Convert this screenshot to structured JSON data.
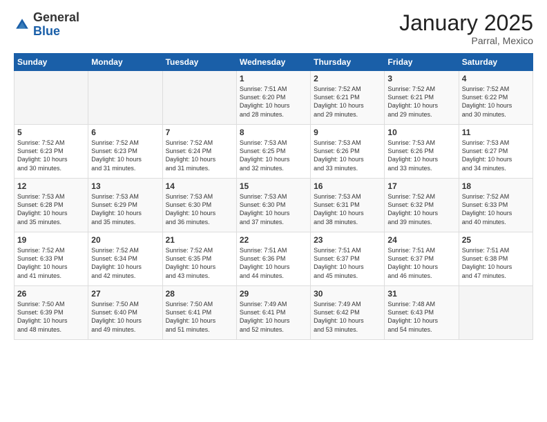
{
  "logo": {
    "general": "General",
    "blue": "Blue"
  },
  "header": {
    "title": "January 2025",
    "subtitle": "Parral, Mexico"
  },
  "days_of_week": [
    "Sunday",
    "Monday",
    "Tuesday",
    "Wednesday",
    "Thursday",
    "Friday",
    "Saturday"
  ],
  "weeks": [
    [
      {
        "day": "",
        "info": ""
      },
      {
        "day": "",
        "info": ""
      },
      {
        "day": "",
        "info": ""
      },
      {
        "day": "1",
        "info": "Sunrise: 7:51 AM\nSunset: 6:20 PM\nDaylight: 10 hours\nand 28 minutes."
      },
      {
        "day": "2",
        "info": "Sunrise: 7:52 AM\nSunset: 6:21 PM\nDaylight: 10 hours\nand 29 minutes."
      },
      {
        "day": "3",
        "info": "Sunrise: 7:52 AM\nSunset: 6:21 PM\nDaylight: 10 hours\nand 29 minutes."
      },
      {
        "day": "4",
        "info": "Sunrise: 7:52 AM\nSunset: 6:22 PM\nDaylight: 10 hours\nand 30 minutes."
      }
    ],
    [
      {
        "day": "5",
        "info": "Sunrise: 7:52 AM\nSunset: 6:23 PM\nDaylight: 10 hours\nand 30 minutes."
      },
      {
        "day": "6",
        "info": "Sunrise: 7:52 AM\nSunset: 6:23 PM\nDaylight: 10 hours\nand 31 minutes."
      },
      {
        "day": "7",
        "info": "Sunrise: 7:52 AM\nSunset: 6:24 PM\nDaylight: 10 hours\nand 31 minutes."
      },
      {
        "day": "8",
        "info": "Sunrise: 7:53 AM\nSunset: 6:25 PM\nDaylight: 10 hours\nand 32 minutes."
      },
      {
        "day": "9",
        "info": "Sunrise: 7:53 AM\nSunset: 6:26 PM\nDaylight: 10 hours\nand 33 minutes."
      },
      {
        "day": "10",
        "info": "Sunrise: 7:53 AM\nSunset: 6:26 PM\nDaylight: 10 hours\nand 33 minutes."
      },
      {
        "day": "11",
        "info": "Sunrise: 7:53 AM\nSunset: 6:27 PM\nDaylight: 10 hours\nand 34 minutes."
      }
    ],
    [
      {
        "day": "12",
        "info": "Sunrise: 7:53 AM\nSunset: 6:28 PM\nDaylight: 10 hours\nand 35 minutes."
      },
      {
        "day": "13",
        "info": "Sunrise: 7:53 AM\nSunset: 6:29 PM\nDaylight: 10 hours\nand 35 minutes."
      },
      {
        "day": "14",
        "info": "Sunrise: 7:53 AM\nSunset: 6:30 PM\nDaylight: 10 hours\nand 36 minutes."
      },
      {
        "day": "15",
        "info": "Sunrise: 7:53 AM\nSunset: 6:30 PM\nDaylight: 10 hours\nand 37 minutes."
      },
      {
        "day": "16",
        "info": "Sunrise: 7:53 AM\nSunset: 6:31 PM\nDaylight: 10 hours\nand 38 minutes."
      },
      {
        "day": "17",
        "info": "Sunrise: 7:52 AM\nSunset: 6:32 PM\nDaylight: 10 hours\nand 39 minutes."
      },
      {
        "day": "18",
        "info": "Sunrise: 7:52 AM\nSunset: 6:33 PM\nDaylight: 10 hours\nand 40 minutes."
      }
    ],
    [
      {
        "day": "19",
        "info": "Sunrise: 7:52 AM\nSunset: 6:33 PM\nDaylight: 10 hours\nand 41 minutes."
      },
      {
        "day": "20",
        "info": "Sunrise: 7:52 AM\nSunset: 6:34 PM\nDaylight: 10 hours\nand 42 minutes."
      },
      {
        "day": "21",
        "info": "Sunrise: 7:52 AM\nSunset: 6:35 PM\nDaylight: 10 hours\nand 43 minutes."
      },
      {
        "day": "22",
        "info": "Sunrise: 7:51 AM\nSunset: 6:36 PM\nDaylight: 10 hours\nand 44 minutes."
      },
      {
        "day": "23",
        "info": "Sunrise: 7:51 AM\nSunset: 6:37 PM\nDaylight: 10 hours\nand 45 minutes."
      },
      {
        "day": "24",
        "info": "Sunrise: 7:51 AM\nSunset: 6:37 PM\nDaylight: 10 hours\nand 46 minutes."
      },
      {
        "day": "25",
        "info": "Sunrise: 7:51 AM\nSunset: 6:38 PM\nDaylight: 10 hours\nand 47 minutes."
      }
    ],
    [
      {
        "day": "26",
        "info": "Sunrise: 7:50 AM\nSunset: 6:39 PM\nDaylight: 10 hours\nand 48 minutes."
      },
      {
        "day": "27",
        "info": "Sunrise: 7:50 AM\nSunset: 6:40 PM\nDaylight: 10 hours\nand 49 minutes."
      },
      {
        "day": "28",
        "info": "Sunrise: 7:50 AM\nSunset: 6:41 PM\nDaylight: 10 hours\nand 51 minutes."
      },
      {
        "day": "29",
        "info": "Sunrise: 7:49 AM\nSunset: 6:41 PM\nDaylight: 10 hours\nand 52 minutes."
      },
      {
        "day": "30",
        "info": "Sunrise: 7:49 AM\nSunset: 6:42 PM\nDaylight: 10 hours\nand 53 minutes."
      },
      {
        "day": "31",
        "info": "Sunrise: 7:48 AM\nSunset: 6:43 PM\nDaylight: 10 hours\nand 54 minutes."
      },
      {
        "day": "",
        "info": ""
      }
    ]
  ]
}
